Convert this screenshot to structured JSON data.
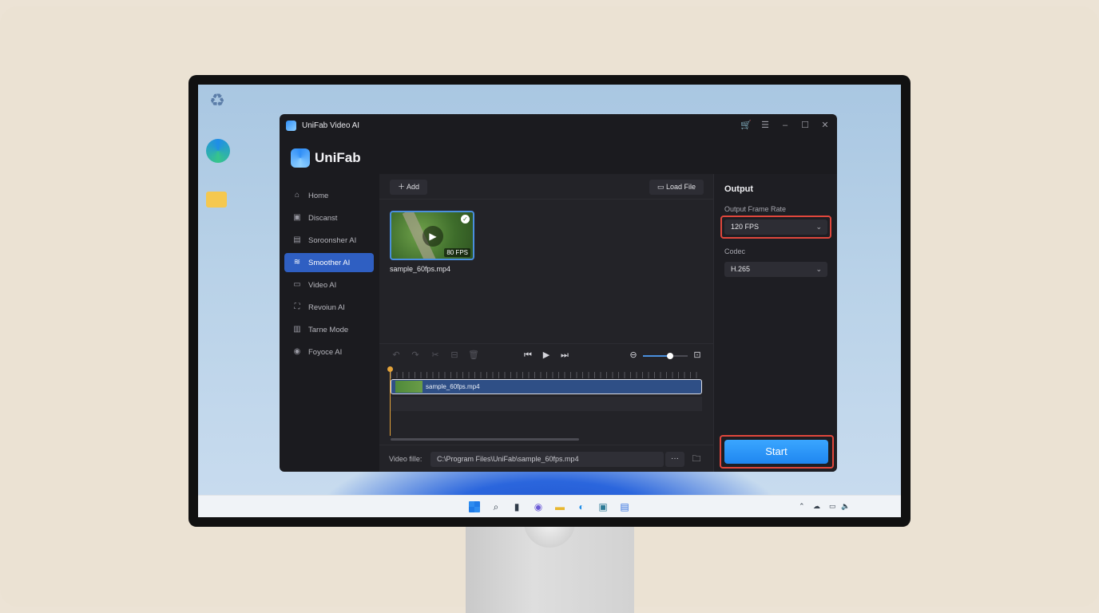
{
  "app": {
    "window_title": "UniFab Video AI",
    "brand_name": "UniFab"
  },
  "sidebar": {
    "items": [
      {
        "label": "Home",
        "icon": "home-icon",
        "active": false
      },
      {
        "label": "Discanst",
        "icon": "film-icon",
        "active": false
      },
      {
        "label": "Soroonsher AI",
        "icon": "enhance-icon",
        "active": false
      },
      {
        "label": "Smoother AI",
        "icon": "smoother-icon",
        "active": true
      },
      {
        "label": "Video AI",
        "icon": "video-icon",
        "active": false
      },
      {
        "label": "Revoiun AI",
        "icon": "scan-icon",
        "active": false
      },
      {
        "label": "Tarne Mode",
        "icon": "document-icon",
        "active": false
      },
      {
        "label": "Foyoce AI",
        "icon": "circle-play-icon",
        "active": false
      }
    ]
  },
  "toolbar": {
    "add_label": "Add",
    "load_file_label": "Load File"
  },
  "media": {
    "filename": "sample_60fps.mp4",
    "fps_badge": "80 FPS"
  },
  "timeline": {
    "clip_label": "sample_60fps.mp4",
    "zoom_level": 0.6
  },
  "file_bar": {
    "label": "Video fille:",
    "path": "C:\\Program Files\\UniFab\\sample_60fps.mp4",
    "more_label": "···"
  },
  "output": {
    "title": "Output",
    "frame_rate_label": "Output Frame Rate",
    "frame_rate_value": "120 FPS",
    "codec_label": "Codec",
    "codec_value": "H.265",
    "start_label": "Start"
  },
  "colors": {
    "accent": "#2f5fc2",
    "start_button": "#2a96f8",
    "highlight": "#e0473c",
    "playhead": "#e4a33a"
  }
}
